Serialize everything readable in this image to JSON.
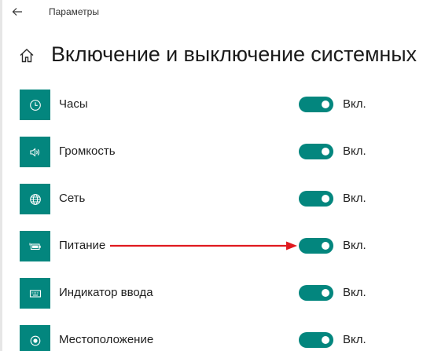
{
  "window": {
    "app_title": "Параметры"
  },
  "header": {
    "page_title": "Включение и выключение системных"
  },
  "items": [
    {
      "label": "Часы",
      "icon": "clock-icon",
      "state": "Вкл.",
      "on": true
    },
    {
      "label": "Громкость",
      "icon": "volume-icon",
      "state": "Вкл.",
      "on": true
    },
    {
      "label": "Сеть",
      "icon": "globe-icon",
      "state": "Вкл.",
      "on": true
    },
    {
      "label": "Питание",
      "icon": "battery-icon",
      "state": "Вкл.",
      "on": true
    },
    {
      "label": "Индикатор ввода",
      "icon": "keyboard-icon",
      "state": "Вкл.",
      "on": true
    },
    {
      "label": "Местоположение",
      "icon": "location-icon",
      "state": "Вкл.",
      "on": true
    }
  ],
  "colors": {
    "accent": "#03867e",
    "annotation_arrow": "#e0191f"
  }
}
